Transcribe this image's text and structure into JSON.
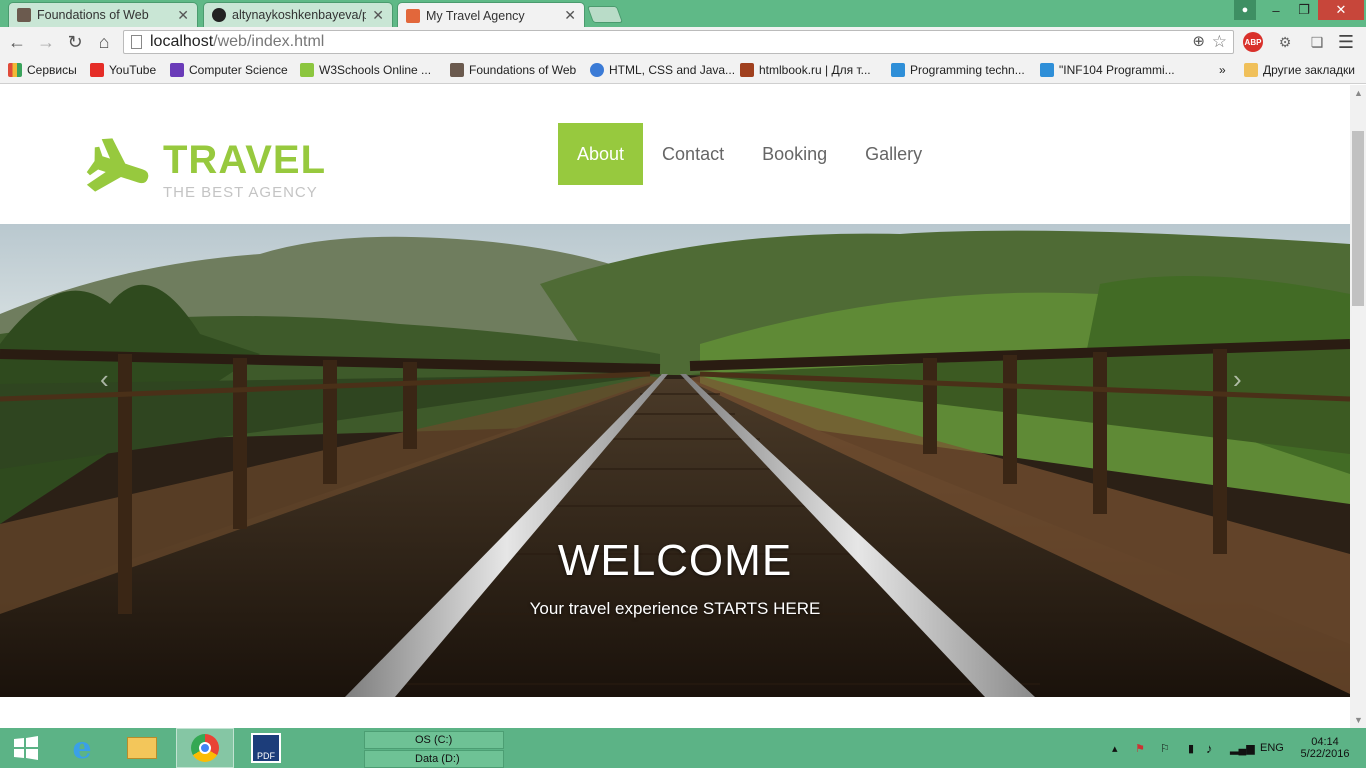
{
  "browser": {
    "tabs": [
      {
        "title": "Foundations of Web",
        "color": "#6b5a4e"
      },
      {
        "title": "altynaykoshkenbayeva/pro",
        "color": "#222222"
      },
      {
        "title": "My Travel Agency",
        "color": "#e2673b"
      }
    ],
    "url_host": "localhost",
    "url_path": "/web/index.html",
    "bookmarks": [
      {
        "label": "Сервисы",
        "color": "#e04b3a"
      },
      {
        "label": "YouTube",
        "color": "#e52d27"
      },
      {
        "label": "Computer Science",
        "color": "#6a3bb8"
      },
      {
        "label": "W3Schools Online ...",
        "color": "#8cc63f"
      },
      {
        "label": "Foundations of Web",
        "color": "#6b5a4e"
      },
      {
        "label": "HTML, CSS and Java...",
        "color": "#3b7bd6"
      },
      {
        "label": "htmlbook.ru | Для т...",
        "color": "#a0401e"
      },
      {
        "label": "Programming techn...",
        "color": "#2f8fd8"
      },
      {
        "label": "\"INF104 Programmi...",
        "color": "#2f8fd8"
      }
    ],
    "more_bookmarks": "»",
    "other_bookmarks": "Другие закладки",
    "adblock_label": "ABP"
  },
  "site": {
    "logo_word": "TRAVEL",
    "logo_sub": "THE BEST AGENCY",
    "accent": "#97c93e",
    "nav": [
      "About",
      "Contact",
      "Booking",
      "Gallery"
    ],
    "active_nav": "About",
    "hero_title": "WELCOME",
    "hero_tagline": "Your travel experience STARTS HERE",
    "prev_arrow": "‹",
    "next_arrow": "›"
  },
  "taskbar": {
    "drive_c": "OS (C:)",
    "drive_d": "Data (D:)",
    "lang": "ENG",
    "time": "04:14",
    "date": "5/22/2016"
  }
}
